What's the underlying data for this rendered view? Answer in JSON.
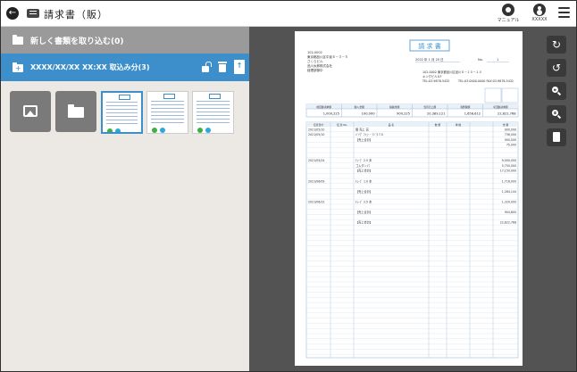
{
  "header": {
    "title": "請求書（販）",
    "manual_label": "マニュアル",
    "user_label": "XXXXX"
  },
  "left_panel": {
    "new_docs_label": "新しく書類を取り込む(0)",
    "imported_label": "XXXX/XX/XX XX:XX 取込み分(3)"
  },
  "invoice": {
    "heading": "請 求 書",
    "postal": "102-0002",
    "address_lines": [
      "東京都品川区中延６－３－５",
      "さくらビル",
      "品川太郎株式会社",
      "経理部御中"
    ],
    "date": "2022 年  1 月  20 日",
    "no_label": "No.",
    "no_value": "1",
    "issuer_lines": [
      "102-0002  東京都品川区品川８－１０－１０",
      "キングビル８F",
      "TEL:03-9876-5432"
    ],
    "issuer_lines_2": [
      "TEL:03-0000-0000  FAX:03-9876-5432"
    ],
    "summary_headers": [
      "前回御請求額",
      "御入金額",
      "繰越金額",
      "当月売上額",
      "消費税額",
      "今回御請求額"
    ],
    "summary_values": [
      "1,000,225",
      "100,000",
      "900,225",
      "20,389,121",
      "1,658,612",
      "22,822,768"
    ],
    "item_headers": [
      "伝票日付",
      "伝 票 No.",
      "品  名",
      "数 量",
      "単 価",
      "金 額"
    ],
    "rows": [
      [
        "2021/05/10",
        "",
        "御 売上 高",
        "",
        "",
        "900,000"
      ],
      [
        "2021/05/10",
        "",
        "ﾊﾟｲﾌﾟ  ﾏｼｭｰ・ﾌｼﾞﾀ  7.0",
        "",
        "",
        "736,000"
      ],
      [
        "",
        "",
        "【売上合計】",
        "",
        "",
        "900,000"
      ],
      [
        "",
        "",
        "",
        "",
        "",
        "75,000"
      ],
      [
        "2021/05/24",
        "",
        "ﾁｭｰﾌﾞ 2.5 本",
        "",
        "",
        "9,000,000"
      ],
      [
        "",
        "",
        "ゴムダンパ",
        "",
        "",
        "5,750,000"
      ],
      [
        "",
        "",
        "【売上合計】",
        "",
        "",
        "17,150,000"
      ],
      [
        "2021/06/09",
        "",
        "ﾁｭｰﾌﾞ 1.0 本",
        "",
        "",
        "1,716,000"
      ],
      [
        "",
        "",
        "【売上合計】",
        "",
        "",
        "1,284,144"
      ],
      [
        "2021/06/22",
        "",
        "ﾁｭｰﾌﾞ 2.5 本",
        "",
        "",
        "1,320,000"
      ],
      [
        "",
        "",
        "【売上合計】",
        "",
        "",
        "904,800"
      ],
      [
        "",
        "",
        "【売上合計】",
        "",
        "",
        "22,822,768"
      ]
    ]
  },
  "viewer_tools": [
    "rotate-cw",
    "rotate-ccw",
    "zoom-in",
    "zoom-out",
    "pdf"
  ]
}
